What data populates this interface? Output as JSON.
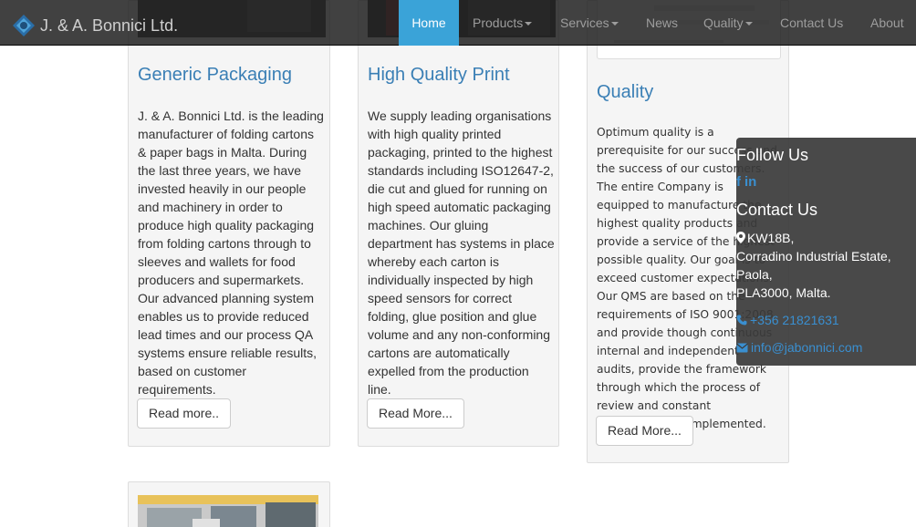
{
  "brand": {
    "name": "J. & A. Bonnici Ltd."
  },
  "nav": [
    {
      "label": "Home",
      "active": true
    },
    {
      "label": "Products",
      "dropdown": true
    },
    {
      "label": "Services",
      "dropdown": true
    },
    {
      "label": "News"
    },
    {
      "label": "Quality",
      "dropdown": true
    },
    {
      "label": "Contact Us"
    },
    {
      "label": "About"
    }
  ],
  "cards": {
    "generic": {
      "title": "Generic Packaging",
      "body": "J. & A. Bonnici Ltd. is the leading manufacturer of folding cartons & paper bags in Malta. During the last three years, we have invested heavily in our people and machinery in order to  produce high quality packaging from folding cartons through to sleeves and wallets for food producers and supermarkets. Our advanced planning system enables us to provide reduced lead times and our process QA systems ensure reliable results, based on customer requirements.",
      "button": "Read more.."
    },
    "print": {
      "title": "High Quality Print",
      "body": "We supply leading organisations with high quality printed packaging, printed to the highest standards including ISO12647-2, die cut and glued for running on high speed automatic packaging machines. Our gluing department has systems in place whereby each carton is individually inspected by high speed sensors for correct folding, glue position and glue volume and any non-conforming cartons are automatically expelled from the production line.",
      "button": "Read More..."
    },
    "quality": {
      "title": "Quality",
      "body": "Optimum quality is a prerequisite for our success and the success of our customers. The entire Company is equipped to manufacture the highest quality products and provide a service of the highest possible quality. Our goal is to exceed customer expectations. Our QMS are based on the requirements of ISO 9001:2008 and provide though continuous internal and independent audits, provide the framework through which the process of review and constant improvement is implemented.",
      "button": "Read More..."
    }
  },
  "follow": {
    "title": "Follow Us",
    "icons": [
      "facebook-icon",
      "linkedin-icon"
    ]
  },
  "contact": {
    "title": "Contact Us",
    "address": [
      "KW18B,",
      "Corradino Industrial Estate,",
      "Paola,",
      "PLA3000, Malta."
    ],
    "phone": "+356 21821631",
    "email": "info@jabonnici.com"
  },
  "colors": {
    "accent": "#3aa3d8",
    "link": "#3a7fb5",
    "navbar": "#222222"
  }
}
